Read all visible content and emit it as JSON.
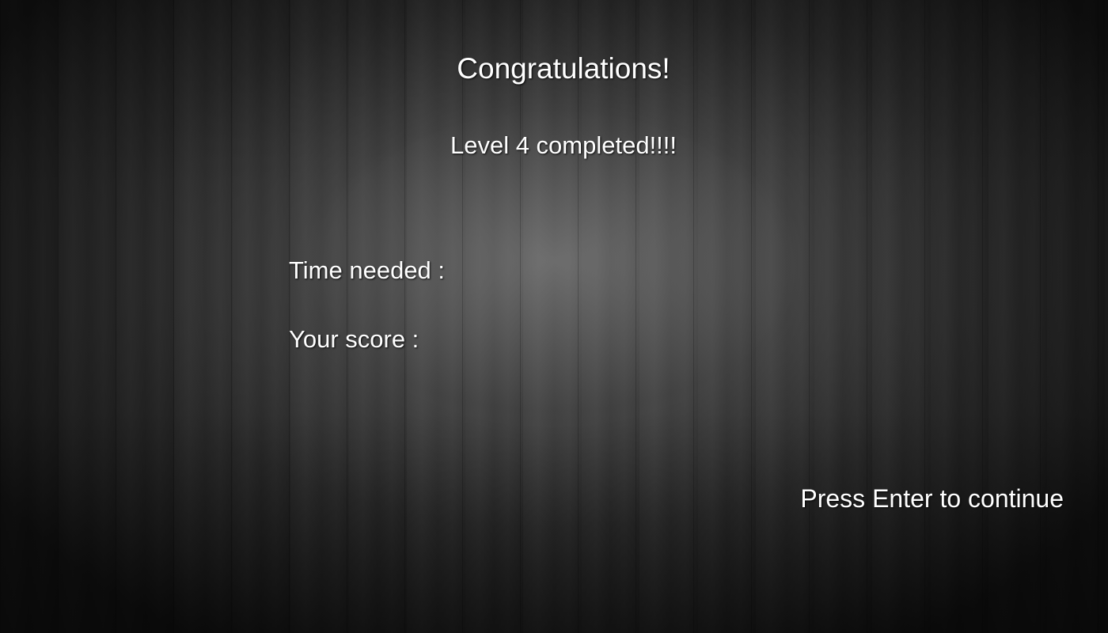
{
  "screen": {
    "title": "Congratulations!",
    "subtitle": "Level 4 completed!!!!",
    "stats": {
      "time_label": "Time needed :",
      "time_value": "",
      "score_label": "Your score :",
      "score_value": ""
    },
    "prompt": "Press Enter to continue"
  },
  "colors": {
    "text": "#ffffff",
    "background": "#2a2a2a"
  }
}
